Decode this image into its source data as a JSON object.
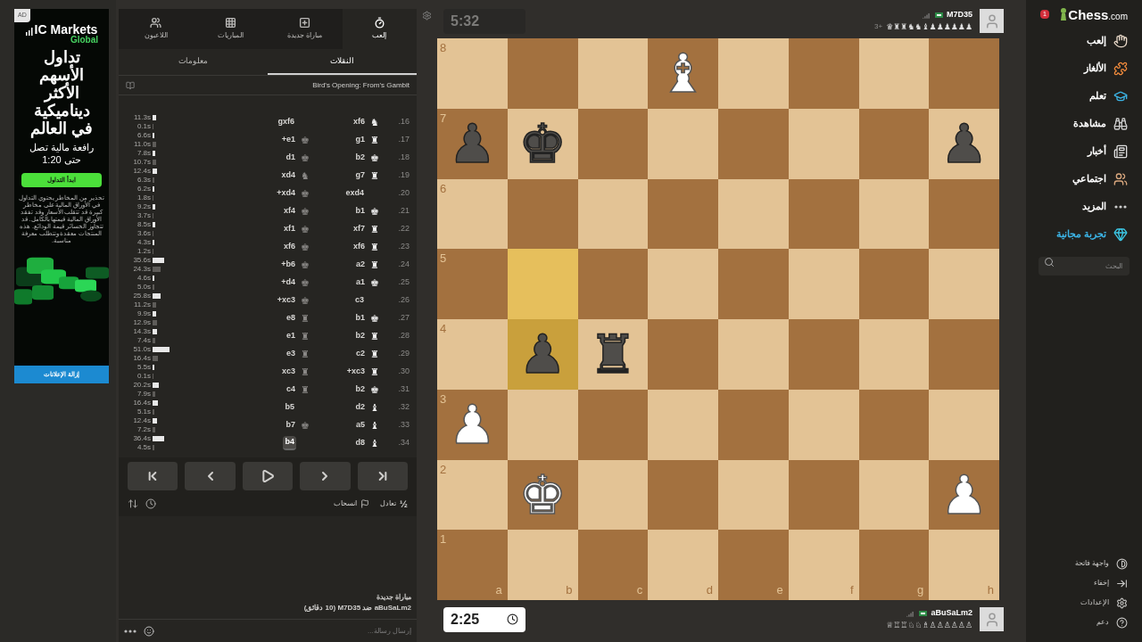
{
  "ad": {
    "label": "AD",
    "brand": "IC Markets",
    "brand_sub": "Global",
    "headline": "تداول الأسهم الأكثر ديناميكية في العالم",
    "subline": "رافعة مالية تصل حتى 1:20",
    "cta": "ابدأ التداول",
    "disclaimer": "تحذير من المخاطر يحتوي التداول في الأوراق المالية على مخاطر كبيرة قد تتقلب الأسعار وقد تفقد الأوراق المالية قيمتها بالكامل. قد تتجاوز الخسائر قيمة الودائع. هذه المنتجات معقدة وتتطلب معرفة مناسبة.",
    "remove_ads": "إزالة الإعلانات"
  },
  "panel": {
    "tabs": [
      {
        "kind": "play",
        "label": "إلعب",
        "selected": true
      },
      {
        "kind": "new",
        "label": "مباراة جديدة",
        "selected": false
      },
      {
        "kind": "games",
        "label": "المباريات",
        "selected": false
      },
      {
        "kind": "players",
        "label": "اللاعبون",
        "selected": false
      }
    ],
    "subtabs": [
      {
        "label": "النقلات",
        "selected": true
      },
      {
        "label": "معلومات",
        "selected": false
      }
    ],
    "opening": "Bird's Opening: From's Gambit",
    "moves": [
      {
        "number": "16.",
        "white": {
          "san": "xf6",
          "piece": "♞",
          "selected": false
        },
        "black": {
          "san": "gxf6",
          "selected": false
        },
        "white_clock": {
          "time": "11.3s"
        },
        "black_clock": {
          "time": "0.1s"
        }
      },
      {
        "number": "17.",
        "white": {
          "san": "g1",
          "piece": "♜",
          "selected": false
        },
        "black": {
          "san": "e1+",
          "piece": "♚",
          "selected": false
        },
        "white_clock": {
          "time": "6.6s"
        },
        "black_clock": {
          "time": "11.0s"
        }
      },
      {
        "number": "18.",
        "white": {
          "san": "b2",
          "piece": "♚",
          "selected": false
        },
        "black": {
          "san": "d1",
          "piece": "♚",
          "selected": false
        },
        "white_clock": {
          "time": "7.8s"
        },
        "black_clock": {
          "time": "10.7s"
        }
      },
      {
        "number": "19.",
        "white": {
          "san": "g7",
          "piece": "♜",
          "selected": false
        },
        "black": {
          "san": "xd4",
          "piece": "♞",
          "selected": false
        },
        "white_clock": {
          "time": "12.4s"
        },
        "black_clock": {
          "time": "6.3s"
        }
      },
      {
        "number": "20.",
        "white": {
          "san": "exd4",
          "selected": false
        },
        "black": {
          "san": "xd4+",
          "piece": "♚",
          "selected": false
        },
        "white_clock": {
          "time": "6.2s"
        },
        "black_clock": {
          "time": "1.8s"
        }
      },
      {
        "number": "21.",
        "white": {
          "san": "b1",
          "piece": "♚",
          "selected": false
        },
        "black": {
          "san": "xf4",
          "piece": "♚",
          "selected": false
        },
        "white_clock": {
          "time": "9.2s"
        },
        "black_clock": {
          "time": "3.7s"
        }
      },
      {
        "number": "22.",
        "white": {
          "san": "xf7",
          "piece": "♜",
          "selected": false
        },
        "black": {
          "san": "xf1",
          "piece": "♚",
          "selected": false
        },
        "white_clock": {
          "time": "8.5s"
        },
        "black_clock": {
          "time": "3.6s"
        }
      },
      {
        "number": "23.",
        "white": {
          "san": "xf6",
          "piece": "♜",
          "selected": false
        },
        "black": {
          "san": "xf6",
          "piece": "♚",
          "selected": false
        },
        "white_clock": {
          "time": "4.3s"
        },
        "black_clock": {
          "time": "1.2s"
        }
      },
      {
        "number": "24.",
        "white": {
          "san": "a2",
          "piece": "♜",
          "selected": false
        },
        "black": {
          "san": "b6+",
          "piece": "♚",
          "selected": false
        },
        "white_clock": {
          "time": "35.6s"
        },
        "black_clock": {
          "time": "24.3s"
        }
      },
      {
        "number": "25.",
        "white": {
          "san": "a1",
          "piece": "♚",
          "selected": false
        },
        "black": {
          "san": "d4+",
          "piece": "♚",
          "selected": false
        },
        "white_clock": {
          "time": "4.6s"
        },
        "black_clock": {
          "time": "5.0s"
        }
      },
      {
        "number": "26.",
        "white": {
          "san": "c3",
          "selected": false
        },
        "black": {
          "san": "xc3+",
          "piece": "♚",
          "selected": false
        },
        "white_clock": {
          "time": "25.8s"
        },
        "black_clock": {
          "time": "11.2s"
        }
      },
      {
        "number": "27.",
        "white": {
          "san": "b1",
          "piece": "♚",
          "selected": false
        },
        "black": {
          "san": "e8",
          "piece": "♜",
          "selected": false
        },
        "white_clock": {
          "time": "9.9s"
        },
        "black_clock": {
          "time": "12.9s"
        }
      },
      {
        "number": "28.",
        "white": {
          "san": "b2",
          "piece": "♜",
          "selected": false
        },
        "black": {
          "san": "e1",
          "piece": "♜",
          "selected": false
        },
        "white_clock": {
          "time": "14.3s"
        },
        "black_clock": {
          "time": "7.4s"
        }
      },
      {
        "number": "29.",
        "white": {
          "san": "c2",
          "piece": "♜",
          "selected": false
        },
        "black": {
          "san": "e3",
          "piece": "♜",
          "selected": false
        },
        "white_clock": {
          "time": "51.0s"
        },
        "black_clock": {
          "time": "16.4s"
        }
      },
      {
        "number": "30.",
        "white": {
          "san": "xc3+",
          "piece": "♜",
          "selected": false
        },
        "black": {
          "san": "xc3",
          "piece": "♜",
          "selected": false
        },
        "white_clock": {
          "time": "5.5s"
        },
        "black_clock": {
          "time": "0.1s"
        }
      },
      {
        "number": "31.",
        "white": {
          "san": "b2",
          "piece": "♚",
          "selected": false
        },
        "black": {
          "san": "c4",
          "piece": "♜",
          "selected": false
        },
        "white_clock": {
          "time": "20.2s"
        },
        "black_clock": {
          "time": "7.9s"
        }
      },
      {
        "number": "32.",
        "white": {
          "san": "d2",
          "piece": "♝",
          "selected": false
        },
        "black": {
          "san": "b5",
          "selected": false
        },
        "white_clock": {
          "time": "16.4s"
        },
        "black_clock": {
          "time": "5.1s"
        }
      },
      {
        "number": "33.",
        "white": {
          "san": "a5",
          "piece": "♝",
          "selected": false
        },
        "black": {
          "san": "b7",
          "piece": "♚",
          "selected": false
        },
        "white_clock": {
          "time": "12.4s"
        },
        "black_clock": {
          "time": "7.2s"
        }
      },
      {
        "number": "34.",
        "white": {
          "san": "d8",
          "piece": "♝",
          "selected": false
        },
        "black": {
          "san": "b4",
          "selected": true
        },
        "white_clock": {
          "time": "36.4s"
        },
        "black_clock": {
          "time": "4.5s"
        }
      }
    ],
    "nav": [
      {
        "kind": "first"
      },
      {
        "kind": "prev"
      },
      {
        "kind": "play"
      },
      {
        "kind": "next"
      },
      {
        "kind": "last"
      }
    ],
    "draw": {
      "symbol": "½",
      "label": "تعادل"
    },
    "resign": "انسحاب",
    "chat": {
      "title": "مباراة جديدة",
      "line": "aBuSaLm2 ضد M7D35 (10 دقائق)",
      "placeholder": "إرسال رسالة..."
    }
  },
  "top_player": {
    "clock": {
      "time": "5:32",
      "active": false
    },
    "name": "M7D35",
    "captured": "♛♜♜♞♞♝♟♟♟♟♟♟",
    "advantage": "3+"
  },
  "bottom_player": {
    "clock": {
      "time": "2:25",
      "active": true
    },
    "name": "aBuSaLm2",
    "captured": "♕♖♖♘♘♗♙♙♙♙♙♙"
  },
  "board": {
    "files": [
      "h",
      "g",
      "f",
      "e",
      "d",
      "c",
      "b",
      "a"
    ],
    "ranks": [
      {
        "label": "8",
        "squares": [
          {
            "highlighted": false
          },
          {
            "highlighted": false
          },
          {
            "highlighted": false
          },
          {
            "highlighted": false
          },
          {
            "highlighted": false,
            "kind": "white",
            "glyph": "♝"
          },
          {
            "highlighted": false
          },
          {
            "highlighted": false
          },
          {
            "highlighted": false
          }
        ]
      },
      {
        "label": "7",
        "squares": [
          {
            "highlighted": false,
            "kind": "black",
            "glyph": "♟"
          },
          {
            "highlighted": false
          },
          {
            "highlighted": false
          },
          {
            "highlighted": false
          },
          {
            "highlighted": false
          },
          {
            "highlighted": false
          },
          {
            "highlighted": false,
            "kind": "black",
            "glyph": "♚"
          },
          {
            "highlighted": false,
            "kind": "black",
            "glyph": "♟"
          }
        ]
      },
      {
        "label": "6",
        "squares": [
          {
            "highlighted": false
          },
          {
            "highlighted": false
          },
          {
            "highlighted": false
          },
          {
            "highlighted": false
          },
          {
            "highlighted": false
          },
          {
            "highlighted": false
          },
          {
            "highlighted": false
          },
          {
            "highlighted": false
          }
        ]
      },
      {
        "label": "5",
        "squares": [
          {
            "highlighted": false
          },
          {
            "highlighted": false
          },
          {
            "highlighted": false
          },
          {
            "highlighted": false
          },
          {
            "highlighted": false
          },
          {
            "highlighted": false
          },
          {
            "highlighted": true
          },
          {
            "highlighted": false
          }
        ]
      },
      {
        "label": "4",
        "squares": [
          {
            "highlighted": false
          },
          {
            "highlighted": false
          },
          {
            "highlighted": false
          },
          {
            "highlighted": false
          },
          {
            "highlighted": false
          },
          {
            "highlighted": false,
            "kind": "black",
            "glyph": "♜"
          },
          {
            "highlighted": true,
            "kind": "black",
            "glyph": "♟"
          },
          {
            "highlighted": false
          }
        ]
      },
      {
        "label": "3",
        "squares": [
          {
            "highlighted": false
          },
          {
            "highlighted": false
          },
          {
            "highlighted": false
          },
          {
            "highlighted": false
          },
          {
            "highlighted": false
          },
          {
            "highlighted": false
          },
          {
            "highlighted": false
          },
          {
            "highlighted": false,
            "kind": "white",
            "glyph": "♟"
          }
        ]
      },
      {
        "label": "2",
        "squares": [
          {
            "highlighted": false,
            "kind": "white",
            "glyph": "♟"
          },
          {
            "highlighted": false
          },
          {
            "highlighted": false
          },
          {
            "highlighted": false
          },
          {
            "highlighted": false
          },
          {
            "highlighted": false
          },
          {
            "highlighted": false,
            "kind": "white",
            "glyph": "♚"
          },
          {
            "highlighted": false
          }
        ]
      },
      {
        "label": "1",
        "squares": [
          {
            "highlighted": false
          },
          {
            "highlighted": false
          },
          {
            "highlighted": false
          },
          {
            "highlighted": false
          },
          {
            "highlighted": false
          },
          {
            "highlighted": false
          },
          {
            "highlighted": false
          },
          {
            "highlighted": false
          }
        ]
      }
    ]
  },
  "sidebar": {
    "logo": "Chess",
    "logo_suffix": ".com",
    "badge": "1",
    "items": [
      {
        "kind": "play",
        "label": "إلعب"
      },
      {
        "kind": "puzzles",
        "label": "الألغاز"
      },
      {
        "kind": "learn",
        "label": "تعلم"
      },
      {
        "kind": "watch",
        "label": "مشاهدة"
      },
      {
        "kind": "news",
        "label": "أخبار"
      },
      {
        "kind": "social",
        "label": "اجتماعي"
      },
      {
        "kind": "more",
        "label": "المزيد"
      },
      {
        "kind": "trial",
        "label": "تجربة مجانية"
      }
    ],
    "search": {
      "placeholder": "البحث"
    },
    "footer": [
      {
        "kind": "theme",
        "label": "واجهة فاتحة"
      },
      {
        "kind": "hide",
        "label": "إخفاء"
      },
      {
        "kind": "settings",
        "label": "الإعدادات"
      },
      {
        "kind": "support",
        "label": "دعم"
      }
    ]
  }
}
